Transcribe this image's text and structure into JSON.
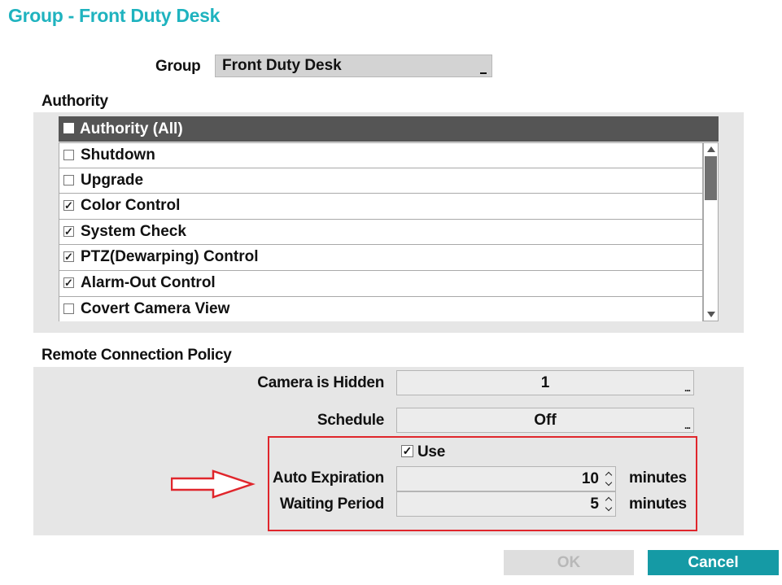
{
  "window": {
    "title": "Group - Front Duty Desk"
  },
  "group": {
    "label": "Group",
    "value": "Front Duty Desk"
  },
  "authority": {
    "section_label": "Authority",
    "header": {
      "label": "Authority (All)",
      "checked": false
    },
    "items": [
      {
        "label": "Shutdown",
        "checked": false
      },
      {
        "label": "Upgrade",
        "checked": false
      },
      {
        "label": "Color Control",
        "checked": true
      },
      {
        "label": "System Check",
        "checked": true
      },
      {
        "label": "PTZ(Dewarping) Control",
        "checked": true
      },
      {
        "label": "Alarm-Out Control",
        "checked": true
      },
      {
        "label": "Covert Camera View",
        "checked": false
      }
    ]
  },
  "remote_policy": {
    "section_label": "Remote Connection Policy",
    "camera_hidden": {
      "label": "Camera is Hidden",
      "value": "1"
    },
    "schedule": {
      "label": "Schedule",
      "value": "Off"
    },
    "use": {
      "label": "Use",
      "checked": true,
      "mark": "☑"
    },
    "auto_expiration": {
      "label": "Auto Expiration",
      "value": "10",
      "unit": "minutes"
    },
    "waiting_period": {
      "label": "Waiting Period",
      "value": "5",
      "unit": "minutes"
    }
  },
  "buttons": {
    "ok": "OK",
    "cancel": "Cancel"
  },
  "colors": {
    "title": "#1fb3bf",
    "highlight": "#e0262c",
    "cancel": "#159aa5",
    "header": "#555555"
  },
  "marks": {
    "check": "✓",
    "more": "..."
  }
}
